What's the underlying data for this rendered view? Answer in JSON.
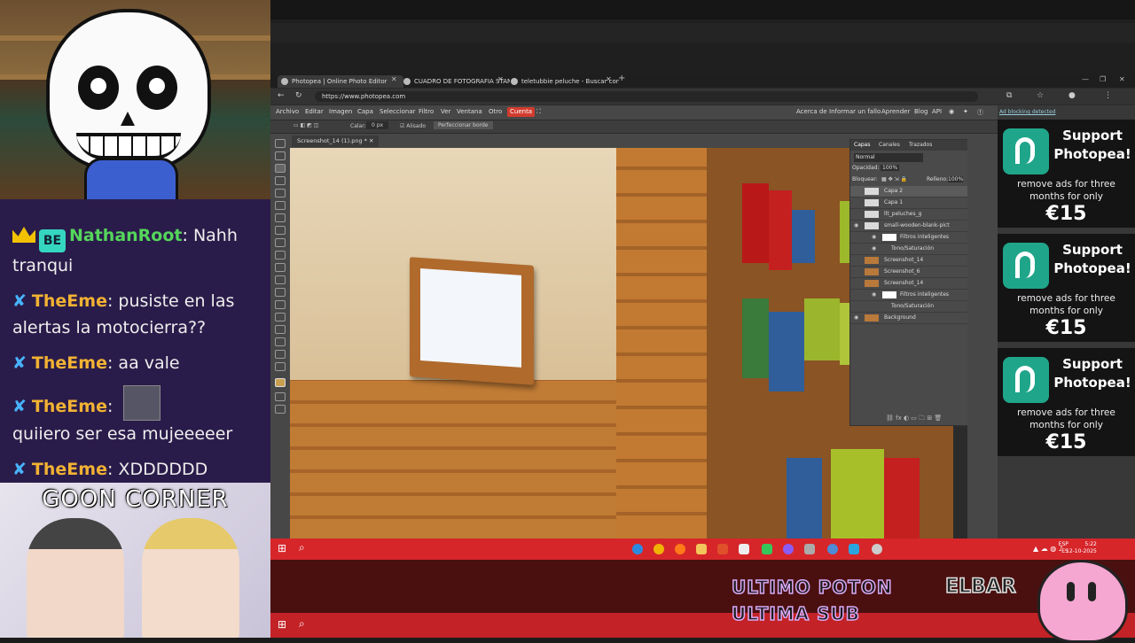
{
  "stream_overlay": {
    "chat": [
      {
        "user": "NathanRoot",
        "text": "Nahh tranqui",
        "badge": "crown",
        "badge2": "BE"
      },
      {
        "user": "TheEme",
        "text": "pusiste en las alertas la motocierra??"
      },
      {
        "user": "TheEme",
        "text": "aa vale"
      },
      {
        "user": "TheEme",
        "text": "quiiero ser esa mujeeeeer"
      },
      {
        "user": "TheEme",
        "text": "XDDDDDD"
      }
    ],
    "goon_banner": "GOON CORNER",
    "ticker": [
      "ULTIMO POTON",
      "ULTIMA SUB"
    ],
    "ticker_right": "ELBAR"
  },
  "browser": {
    "tabs": [
      {
        "label": "Photopea | Online Photo Editor",
        "active": true
      },
      {
        "label": "CUADRO DE FOTOGRAFIA STAN",
        "active": false
      },
      {
        "label": "teletubbie peluche - Buscar con G",
        "active": false
      }
    ],
    "new_tab": "+",
    "url": "https://www.photopea.com"
  },
  "photopea": {
    "menu": [
      "Archivo",
      "Editar",
      "Imagen",
      "Capa",
      "Seleccionar",
      "Filtro",
      "Ver",
      "Ventana",
      "Otro"
    ],
    "account": "Cuenta",
    "menu_right": [
      "Acerca de",
      "Informar un fallo",
      "Aprender",
      "Blog",
      "API"
    ],
    "options": {
      "feather_label": "Calar:",
      "feather_value": "0 px",
      "antialias": "Alisado",
      "refine": "Perfeccionar borde"
    },
    "doc_tab": "Screenshot_14 (1).png *",
    "panel_tabs": [
      "Capas",
      "Canales",
      "Trazados"
    ],
    "blend_mode": "Normal",
    "opacity_label": "Opacidad:",
    "opacity": "100%",
    "lock_label": "Bloquear:",
    "fill_label": "Relleno:",
    "fill": "100%",
    "layers": [
      {
        "name": "Capa 2"
      },
      {
        "name": "Capa 1"
      },
      {
        "name": "llt_peluches_g"
      },
      {
        "name": "small-wooden-blank-pict"
      },
      {
        "name": "Filtros inteligentes"
      },
      {
        "name": "Tono/Saturación"
      },
      {
        "name": "Screenshot_14"
      },
      {
        "name": "Screenshot_6"
      },
      {
        "name": "Screenshot_14"
      },
      {
        "name": "Filtros inteligentes"
      },
      {
        "name": "Tono/Saturación"
      },
      {
        "name": "Background"
      }
    ]
  },
  "ad": {
    "adblock_notice": "Ad blocking detected",
    "cards": [
      {
        "title": "Support Photopea!",
        "subtitle": "remove ads for three months for only",
        "price": "€15"
      },
      {
        "title": "Support Photopea!",
        "subtitle": "remove ads for three months for only",
        "price": "€15"
      },
      {
        "title": "Support Photopea!",
        "subtitle": "remove ads for three months for only",
        "price": "€15"
      }
    ]
  },
  "taskbar": {
    "lang": "ESP\nES",
    "time": "5:22",
    "date": "12-10-2025"
  },
  "colors": {
    "accent_red": "#d23b2e",
    "photopea_green": "#1fa58a",
    "taskbar_red": "#d6262a"
  }
}
